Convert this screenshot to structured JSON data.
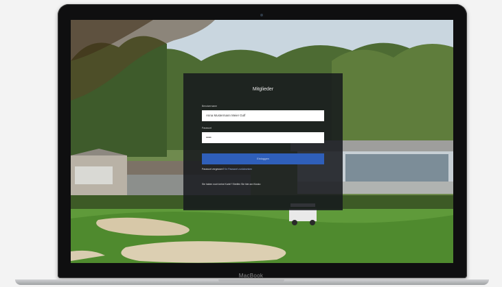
{
  "device": {
    "brand_label": "MacBook"
  },
  "login": {
    "title": "Mitglieder",
    "username_label": "Benutzername",
    "username_value": "Anna Mustermann Meier Golf",
    "password_label": "Passwort",
    "password_value": "•••••",
    "submit_label": "Einloggen",
    "forgot_prefix": "Passwort vergessen?",
    "forgot_link": "Ihr Passwort zurücksetzen",
    "no_card_text": "Sie haben noch keine Karte? Streifen Sie hier am Kiosko"
  },
  "colors": {
    "panel_bg": "#16191d",
    "button_bg": "#2f5fba",
    "field_bg": "#ffffff"
  }
}
